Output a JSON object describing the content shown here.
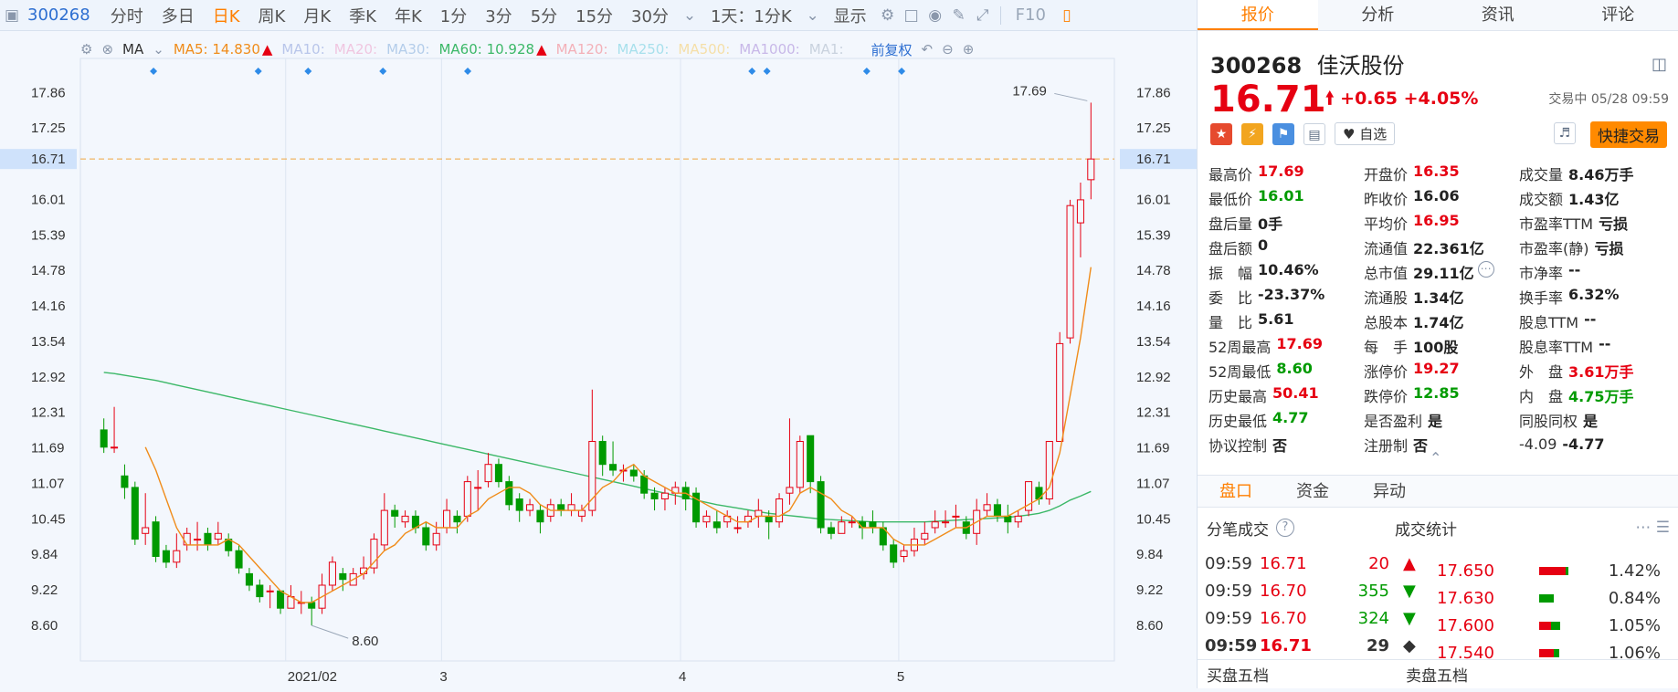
{
  "toolbar": {
    "code": "300268",
    "periods": [
      "分时",
      "多日",
      "日K",
      "周K",
      "月K",
      "季K",
      "年K",
      "1分",
      "3分",
      "5分",
      "15分",
      "30分"
    ],
    "active_period": "日K",
    "mode": "1天：1分K",
    "display": "显示",
    "f10": "F10"
  },
  "ma_bar": {
    "type": "MA",
    "ma5_label": "MA5: 14.830",
    "ma10": "MA10:",
    "ma20": "MA20:",
    "ma30": "MA30:",
    "ma60_label": "MA60: 10.928",
    "ma120": "MA120:",
    "ma250": "MA250:",
    "ma500": "MA500:",
    "ma1000": "MA1000:",
    "ma1": "MA1:",
    "adjust": "前复权"
  },
  "colors": {
    "up": "#e60012",
    "down": "#009a00",
    "ma5": "#f08c1a",
    "ma60": "#3cb868",
    "accent": "#ff7f00"
  },
  "chart_data": {
    "type": "candlestick",
    "ylim": [
      8.3,
      18.3
    ],
    "yticks": [
      "17.86",
      "17.25",
      "16.71",
      "16.01",
      "15.39",
      "14.78",
      "14.16",
      "13.54",
      "12.92",
      "12.31",
      "11.69",
      "11.07",
      "10.45",
      "9.84",
      "9.22",
      "8.60"
    ],
    "current_price": 16.71,
    "xlabels": [
      {
        "label": "2021/02",
        "index": 18
      },
      {
        "label": "3",
        "index": 33
      },
      {
        "label": "4",
        "index": 56
      },
      {
        "label": "5",
        "index": 77
      }
    ],
    "high_marker": "17.69",
    "low_marker": "8.60",
    "candles": [
      [
        12.0,
        11.7,
        12.2,
        11.6
      ],
      [
        11.7,
        11.7,
        12.4,
        11.6
      ],
      [
        11.2,
        11.0,
        11.4,
        10.8
      ],
      [
        11.0,
        10.1,
        11.1,
        10.0
      ],
      [
        10.2,
        10.3,
        10.9,
        10.0
      ],
      [
        10.4,
        9.8,
        10.5,
        9.7
      ],
      [
        9.9,
        9.7,
        10.0,
        9.6
      ],
      [
        9.7,
        9.9,
        10.2,
        9.6
      ],
      [
        10.0,
        10.2,
        10.3,
        9.9
      ],
      [
        10.1,
        10.1,
        10.4,
        9.9
      ],
      [
        10.2,
        10.0,
        10.3,
        9.9
      ],
      [
        10.1,
        10.2,
        10.4,
        10.0
      ],
      [
        10.1,
        9.9,
        10.2,
        9.8
      ],
      [
        9.9,
        9.6,
        10.0,
        9.5
      ],
      [
        9.5,
        9.3,
        9.6,
        9.2
      ],
      [
        9.3,
        9.1,
        9.4,
        9.0
      ],
      [
        9.2,
        9.2,
        9.3,
        8.9
      ],
      [
        9.2,
        8.9,
        9.2,
        8.8
      ],
      [
        8.9,
        9.1,
        9.3,
        8.9
      ],
      [
        9.0,
        9.0,
        9.2,
        8.8
      ],
      [
        9.0,
        8.9,
        9.1,
        8.6
      ],
      [
        8.9,
        9.3,
        9.5,
        8.8
      ],
      [
        9.3,
        9.7,
        9.8,
        9.2
      ],
      [
        9.5,
        9.4,
        9.6,
        9.2
      ],
      [
        9.3,
        9.5,
        9.6,
        9.3
      ],
      [
        9.5,
        9.6,
        9.8,
        9.4
      ],
      [
        9.6,
        10.1,
        10.2,
        9.5
      ],
      [
        10.0,
        10.6,
        10.9,
        9.9
      ],
      [
        10.6,
        10.5,
        10.7,
        10.3
      ],
      [
        10.4,
        10.5,
        10.6,
        10.3
      ],
      [
        10.5,
        10.3,
        10.6,
        10.2
      ],
      [
        10.3,
        10.0,
        10.4,
        9.9
      ],
      [
        10.0,
        10.2,
        10.4,
        9.9
      ],
      [
        10.3,
        10.6,
        10.8,
        10.2
      ],
      [
        10.5,
        10.4,
        10.6,
        10.2
      ],
      [
        10.5,
        11.1,
        11.2,
        10.4
      ],
      [
        11.0,
        11.0,
        11.3,
        10.6
      ],
      [
        11.1,
        11.4,
        11.6,
        11.0
      ],
      [
        11.4,
        11.1,
        11.5,
        11.0
      ],
      [
        11.1,
        10.7,
        11.2,
        10.6
      ],
      [
        10.8,
        10.6,
        10.9,
        10.4
      ],
      [
        10.6,
        10.7,
        10.8,
        10.5
      ],
      [
        10.6,
        10.4,
        10.7,
        10.2
      ],
      [
        10.5,
        10.7,
        10.8,
        10.4
      ],
      [
        10.7,
        10.6,
        10.8,
        10.5
      ],
      [
        10.6,
        10.7,
        10.9,
        10.5
      ],
      [
        10.5,
        10.6,
        10.7,
        10.4
      ],
      [
        10.6,
        11.8,
        12.7,
        10.5
      ],
      [
        11.8,
        11.4,
        11.9,
        11.2
      ],
      [
        11.4,
        11.3,
        11.8,
        11.2
      ],
      [
        11.3,
        11.3,
        11.4,
        11.1
      ],
      [
        11.3,
        11.2,
        11.4,
        11.1
      ],
      [
        11.2,
        10.9,
        11.3,
        10.8
      ],
      [
        10.9,
        10.8,
        11.0,
        10.6
      ],
      [
        10.8,
        10.9,
        11.0,
        10.6
      ],
      [
        10.9,
        11.0,
        11.1,
        10.7
      ],
      [
        11.0,
        10.8,
        11.1,
        10.6
      ],
      [
        10.9,
        10.4,
        11.0,
        10.3
      ],
      [
        10.4,
        10.5,
        10.6,
        10.3
      ],
      [
        10.4,
        10.3,
        10.6,
        10.2
      ],
      [
        10.4,
        10.5,
        10.6,
        10.3
      ],
      [
        10.3,
        10.3,
        10.5,
        10.2
      ],
      [
        10.4,
        10.5,
        10.6,
        10.3
      ],
      [
        10.5,
        10.6,
        10.8,
        10.3
      ],
      [
        10.5,
        10.4,
        10.6,
        10.1
      ],
      [
        10.4,
        10.8,
        10.9,
        10.3
      ],
      [
        10.9,
        11.0,
        12.2,
        10.7
      ],
      [
        11.0,
        11.8,
        11.9,
        10.9
      ],
      [
        11.9,
        11.1,
        11.9,
        10.9
      ],
      [
        11.1,
        10.3,
        11.2,
        10.2
      ],
      [
        10.3,
        10.2,
        10.4,
        10.1
      ],
      [
        10.2,
        10.4,
        10.5,
        10.2
      ],
      [
        10.4,
        10.4,
        10.5,
        10.3
      ],
      [
        10.4,
        10.3,
        10.5,
        10.1
      ],
      [
        10.4,
        10.3,
        10.6,
        10.2
      ],
      [
        10.3,
        10.0,
        10.4,
        9.9
      ],
      [
        10.0,
        9.7,
        10.1,
        9.6
      ],
      [
        9.8,
        9.9,
        10.0,
        9.7
      ],
      [
        9.9,
        10.1,
        10.3,
        9.8
      ],
      [
        10.1,
        10.2,
        10.4,
        10.0
      ],
      [
        10.3,
        10.4,
        10.6,
        10.2
      ],
      [
        10.4,
        10.4,
        10.6,
        10.3
      ],
      [
        10.5,
        10.5,
        10.7,
        10.3
      ],
      [
        10.4,
        10.2,
        10.5,
        10.1
      ],
      [
        10.2,
        10.6,
        10.8,
        10.0
      ],
      [
        10.6,
        10.7,
        10.9,
        10.5
      ],
      [
        10.7,
        10.5,
        10.8,
        10.4
      ],
      [
        10.5,
        10.4,
        10.7,
        10.2
      ],
      [
        10.4,
        10.5,
        10.6,
        10.3
      ],
      [
        10.6,
        11.1,
        11.1,
        10.5
      ],
      [
        11.0,
        10.8,
        11.1,
        10.7
      ],
      [
        10.8,
        11.8,
        11.8,
        10.7
      ],
      [
        11.8,
        13.5,
        13.7,
        11.8
      ],
      [
        13.6,
        15.9,
        16.0,
        13.5
      ],
      [
        15.6,
        16.0,
        16.3,
        15.0
      ],
      [
        16.35,
        16.71,
        17.69,
        16.01
      ]
    ],
    "ma5": [
      null,
      null,
      null,
      null,
      11.7,
      11.3,
      10.8,
      10.3,
      10.0,
      10.0,
      10.0,
      10.0,
      10.1,
      10.0,
      9.8,
      9.6,
      9.4,
      9.2,
      9.1,
      9.0,
      9.0,
      9.1,
      9.2,
      9.3,
      9.4,
      9.5,
      9.7,
      9.9,
      10.0,
      10.2,
      10.3,
      10.4,
      10.3,
      10.3,
      10.3,
      10.5,
      10.6,
      10.8,
      10.9,
      11.0,
      11.0,
      10.9,
      10.7,
      10.6,
      10.6,
      10.6,
      10.6,
      10.8,
      11.0,
      11.1,
      11.3,
      11.4,
      11.2,
      11.1,
      11.0,
      10.9,
      10.9,
      10.8,
      10.7,
      10.6,
      10.5,
      10.4,
      10.4,
      10.5,
      10.5,
      10.5,
      10.6,
      10.9,
      11.0,
      10.9,
      10.8,
      10.6,
      10.5,
      10.3,
      10.3,
      10.3,
      10.1,
      10.0,
      10.0,
      10.0,
      10.1,
      10.2,
      10.3,
      10.3,
      10.4,
      10.5,
      10.5,
      10.5,
      10.6,
      10.7,
      10.8,
      11.0,
      11.6,
      12.6,
      13.6,
      14.83
    ],
    "ma60": [
      13.0,
      12.98,
      12.95,
      12.92,
      12.89,
      12.86,
      12.82,
      12.78,
      12.74,
      12.7,
      12.66,
      12.62,
      12.58,
      12.54,
      12.5,
      12.46,
      12.42,
      12.38,
      12.34,
      12.3,
      12.26,
      12.22,
      12.18,
      12.14,
      12.1,
      12.06,
      12.02,
      11.98,
      11.94,
      11.9,
      11.86,
      11.82,
      11.78,
      11.74,
      11.7,
      11.66,
      11.62,
      11.58,
      11.54,
      11.5,
      11.46,
      11.42,
      11.38,
      11.34,
      11.3,
      11.26,
      11.22,
      11.18,
      11.14,
      11.1,
      11.06,
      11.02,
      10.98,
      10.94,
      10.9,
      10.86,
      10.82,
      10.78,
      10.74,
      10.7,
      10.67,
      10.64,
      10.61,
      10.58,
      10.55,
      10.53,
      10.51,
      10.49,
      10.47,
      10.45,
      10.44,
      10.43,
      10.42,
      10.41,
      10.4,
      10.4,
      10.4,
      10.4,
      10.4,
      10.4,
      10.41,
      10.42,
      10.43,
      10.44,
      10.45,
      10.46,
      10.47,
      10.48,
      10.5,
      10.52,
      10.55,
      10.6,
      10.68,
      10.78,
      10.85,
      10.93
    ]
  },
  "quote": {
    "code": "300268",
    "name": "佳沃股份",
    "price": "16.71",
    "change": "+0.65",
    "change_pct": "+4.05%",
    "status": "交易中 05/28 09:59",
    "watch_label": "自选",
    "fast_trade": "快捷交易"
  },
  "tabs": [
    "报价",
    "分析",
    "资讯",
    "评论"
  ],
  "stats": [
    [
      {
        "k": "最高价",
        "v": "17.69",
        "c": "red"
      },
      {
        "k": "开盘价",
        "v": "16.35",
        "c": "red"
      },
      {
        "k": "成交量",
        "v": "8.46万手",
        "c": ""
      }
    ],
    [
      {
        "k": "最低价",
        "v": "16.01",
        "c": "green"
      },
      {
        "k": "昨收价",
        "v": "16.06",
        "c": ""
      },
      {
        "k": "成交额",
        "v": "1.43亿",
        "c": ""
      }
    ],
    [
      {
        "k": "盘后量",
        "v": "0手",
        "c": ""
      },
      {
        "k": "平均价",
        "v": "16.95",
        "c": "red"
      },
      {
        "k": "市盈率TTM",
        "v": "亏损",
        "c": ""
      }
    ],
    [
      {
        "k": "盘后额",
        "v": "0",
        "c": ""
      },
      {
        "k": "流通值",
        "v": "22.361亿",
        "c": ""
      },
      {
        "k": "市盈率(静)",
        "v": "亏损",
        "c": ""
      }
    ],
    [
      {
        "k": "振　幅",
        "v": "10.46%",
        "c": ""
      },
      {
        "k": "总市值",
        "v": "29.11亿",
        "c": ""
      },
      {
        "k": "市净率",
        "v": "--",
        "c": ""
      }
    ],
    [
      {
        "k": "委　比",
        "v": "-23.37%",
        "c": ""
      },
      {
        "k": "流通股",
        "v": "1.34亿",
        "c": ""
      },
      {
        "k": "换手率",
        "v": "6.32%",
        "c": ""
      }
    ],
    [
      {
        "k": "量　比",
        "v": "5.61",
        "c": ""
      },
      {
        "k": "总股本",
        "v": "1.74亿",
        "c": ""
      },
      {
        "k": "股息TTM",
        "v": "--",
        "c": ""
      }
    ],
    [
      {
        "k": "52周最高",
        "v": "17.69",
        "c": "red"
      },
      {
        "k": "每　手",
        "v": "100股",
        "c": ""
      },
      {
        "k": "股息率TTM",
        "v": "--",
        "c": ""
      }
    ],
    [
      {
        "k": "52周最低",
        "v": "8.60",
        "c": "green"
      },
      {
        "k": "涨停价",
        "v": "19.27",
        "c": "red"
      },
      {
        "k": "外　盘",
        "v": "3.61万手",
        "c": "red"
      }
    ],
    [
      {
        "k": "历史最高",
        "v": "50.41",
        "c": "red"
      },
      {
        "k": "跌停价",
        "v": "12.85",
        "c": "green"
      },
      {
        "k": "内　盘",
        "v": "4.75万手",
        "c": "green"
      }
    ],
    [
      {
        "k": "历史最低",
        "v": "4.77",
        "c": "green"
      },
      {
        "k": "是否盈利",
        "v": "是",
        "c": ""
      },
      {
        "k": "同股同权",
        "v": "是",
        "c": ""
      }
    ],
    [
      {
        "k": "协议控制",
        "v": "否",
        "c": ""
      },
      {
        "k": "注册制",
        "v": "否",
        "c": ""
      },
      {
        "k": "-4.09",
        "v": "-4.77",
        "c": ""
      }
    ]
  ],
  "bottom_tabs": [
    "盘口",
    "资金",
    "异动"
  ],
  "ticks": {
    "title": "分笔成交",
    "stats_title": "成交统计",
    "rows": [
      {
        "time": "09:59",
        "price": "16.71",
        "vol": "20",
        "dir": "▲",
        "c": "red"
      },
      {
        "time": "09:59",
        "price": "16.70",
        "vol": "355",
        "dir": "▼",
        "c": "green"
      },
      {
        "time": "09:59",
        "price": "16.70",
        "vol": "324",
        "dir": "▼",
        "c": "green"
      },
      {
        "time": "09:59",
        "price": "16.71",
        "vol": "29",
        "dir": "◆",
        "c": ""
      }
    ],
    "dist": [
      {
        "price": "17.650",
        "pct": "1.42%",
        "buy": 0.9,
        "sell": 0.1
      },
      {
        "price": "17.630",
        "pct": "0.84%",
        "buy": 0.0,
        "sell": 0.5
      },
      {
        "price": "17.600",
        "pct": "1.05%",
        "buy": 0.4,
        "sell": 0.3
      },
      {
        "price": "17.540",
        "pct": "1.06%",
        "buy": 0.5,
        "sell": 0.2
      }
    ]
  },
  "bottom": {
    "buy5": "买盘五档",
    "sell5": "卖盘五档"
  }
}
